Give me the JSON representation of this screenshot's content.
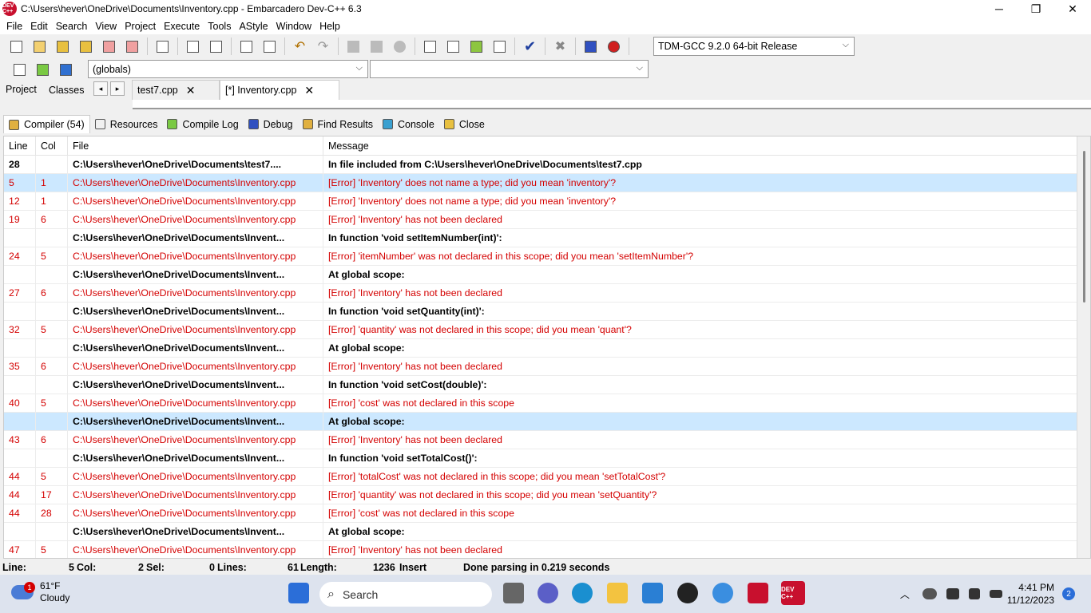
{
  "window": {
    "title": "C:\\Users\\hever\\OneDrive\\Documents\\Inventory.cpp - Embarcadero Dev-C++ 6.3",
    "logo_text": "DEV C++",
    "minimize": "─",
    "maximize": "❐",
    "close": "✕"
  },
  "menu": [
    "File",
    "Edit",
    "Search",
    "View",
    "Project",
    "Execute",
    "Tools",
    "AStyle",
    "Window",
    "Help"
  ],
  "toolbar": {
    "compiler_select": "TDM-GCC 9.2.0 64-bit Release",
    "scope_select": "(globals)",
    "member_select": ""
  },
  "left_tabs": [
    "Project",
    "Classes"
  ],
  "file_tabs": [
    {
      "label": "test7.cpp",
      "active": false
    },
    {
      "label": "[*] Inventory.cpp",
      "active": true
    }
  ],
  "bottom_tabs": [
    {
      "label": "Compiler (54)",
      "icon": "compiler-icon"
    },
    {
      "label": "Resources",
      "icon": "resources-icon"
    },
    {
      "label": "Compile Log",
      "icon": "compile-log-icon"
    },
    {
      "label": "Debug",
      "icon": "debug-icon"
    },
    {
      "label": "Find Results",
      "icon": "find-results-icon"
    },
    {
      "label": "Console",
      "icon": "console-icon"
    },
    {
      "label": "Close",
      "icon": "close-panel-icon"
    }
  ],
  "grid": {
    "headers": {
      "line": "Line",
      "col": "Col",
      "file": "File",
      "message": "Message"
    },
    "rows": [
      {
        "type": "info",
        "line": "28",
        "col": "",
        "file": "C:\\Users\\hever\\OneDrive\\Documents\\test7....",
        "message": "In file included from C:\\Users\\hever\\OneDrive\\Documents\\test7.cpp"
      },
      {
        "type": "error",
        "selected": true,
        "line": "5",
        "col": "1",
        "file": "C:\\Users\\hever\\OneDrive\\Documents\\Inventory.cpp",
        "message": "[Error] 'Inventory' does not name a type; did you mean 'inventory'?"
      },
      {
        "type": "error",
        "line": "12",
        "col": "1",
        "file": "C:\\Users\\hever\\OneDrive\\Documents\\Inventory.cpp",
        "message": "[Error] 'Inventory' does not name a type; did you mean 'inventory'?"
      },
      {
        "type": "error",
        "line": "19",
        "col": "6",
        "file": "C:\\Users\\hever\\OneDrive\\Documents\\Inventory.cpp",
        "message": "[Error] 'Inventory' has not been declared"
      },
      {
        "type": "info",
        "line": "",
        "col": "",
        "file": "C:\\Users\\hever\\OneDrive\\Documents\\Invent...",
        "message": "In function 'void setItemNumber(int)':"
      },
      {
        "type": "error",
        "line": "24",
        "col": "5",
        "file": "C:\\Users\\hever\\OneDrive\\Documents\\Inventory.cpp",
        "message": "[Error] 'itemNumber' was not declared in this scope; did you mean 'setItemNumber'?"
      },
      {
        "type": "info",
        "line": "",
        "col": "",
        "file": "C:\\Users\\hever\\OneDrive\\Documents\\Invent...",
        "message": "At global scope:"
      },
      {
        "type": "error",
        "line": "27",
        "col": "6",
        "file": "C:\\Users\\hever\\OneDrive\\Documents\\Inventory.cpp",
        "message": "[Error] 'Inventory' has not been declared"
      },
      {
        "type": "info",
        "line": "",
        "col": "",
        "file": "C:\\Users\\hever\\OneDrive\\Documents\\Invent...",
        "message": "In function 'void setQuantity(int)':"
      },
      {
        "type": "error",
        "line": "32",
        "col": "5",
        "file": "C:\\Users\\hever\\OneDrive\\Documents\\Inventory.cpp",
        "message": "[Error] 'quantity' was not declared in this scope; did you mean 'quant'?"
      },
      {
        "type": "info",
        "line": "",
        "col": "",
        "file": "C:\\Users\\hever\\OneDrive\\Documents\\Invent...",
        "message": "At global scope:"
      },
      {
        "type": "error",
        "line": "35",
        "col": "6",
        "file": "C:\\Users\\hever\\OneDrive\\Documents\\Inventory.cpp",
        "message": "[Error] 'Inventory' has not been declared"
      },
      {
        "type": "info",
        "line": "",
        "col": "",
        "file": "C:\\Users\\hever\\OneDrive\\Documents\\Invent...",
        "message": "In function 'void setCost(double)':"
      },
      {
        "type": "error",
        "line": "40",
        "col": "5",
        "file": "C:\\Users\\hever\\OneDrive\\Documents\\Inventory.cpp",
        "message": "[Error] 'cost' was not declared in this scope"
      },
      {
        "type": "info",
        "selected": true,
        "line": "",
        "col": "",
        "file": "C:\\Users\\hever\\OneDrive\\Documents\\Invent...",
        "message": "At global scope:"
      },
      {
        "type": "error",
        "line": "43",
        "col": "6",
        "file": "C:\\Users\\hever\\OneDrive\\Documents\\Inventory.cpp",
        "message": "[Error] 'Inventory' has not been declared"
      },
      {
        "type": "info",
        "line": "",
        "col": "",
        "file": "C:\\Users\\hever\\OneDrive\\Documents\\Invent...",
        "message": "In function 'void setTotalCost()':"
      },
      {
        "type": "error",
        "line": "44",
        "col": "5",
        "file": "C:\\Users\\hever\\OneDrive\\Documents\\Inventory.cpp",
        "message": "[Error] 'totalCost' was not declared in this scope; did you mean 'setTotalCost'?"
      },
      {
        "type": "error",
        "line": "44",
        "col": "17",
        "file": "C:\\Users\\hever\\OneDrive\\Documents\\Inventory.cpp",
        "message": "[Error] 'quantity' was not declared in this scope; did you mean 'setQuantity'?"
      },
      {
        "type": "error",
        "line": "44",
        "col": "28",
        "file": "C:\\Users\\hever\\OneDrive\\Documents\\Inventory.cpp",
        "message": "[Error] 'cost' was not declared in this scope"
      },
      {
        "type": "info",
        "line": "",
        "col": "",
        "file": "C:\\Users\\hever\\OneDrive\\Documents\\Invent...",
        "message": "At global scope:"
      },
      {
        "type": "error",
        "line": "47",
        "col": "5",
        "file": "C:\\Users\\hever\\OneDrive\\Documents\\Inventory.cpp",
        "message": "[Error] 'Inventory' has not been declared"
      }
    ]
  },
  "status": {
    "line": "Line:",
    "line_val": "5",
    "col": "Col:",
    "col_val": "2",
    "sel": "Sel:",
    "sel_val": "0",
    "lines": "Lines:",
    "lines_val": "61",
    "length": "Length:",
    "length_val": "1236",
    "mode": "Insert",
    "message": "Done parsing in 0.219 seconds"
  },
  "taskbar": {
    "weather_temp": "61°F",
    "weather_desc": "Cloudy",
    "weather_badge": "1",
    "search_placeholder": "Search",
    "time": "4:41 PM",
    "date": "11/12/2023",
    "notifications": "2",
    "devcpp_label": "DEV C++"
  },
  "colors": {
    "error_text": "#d40000",
    "selected_row": "#cce8ff"
  }
}
